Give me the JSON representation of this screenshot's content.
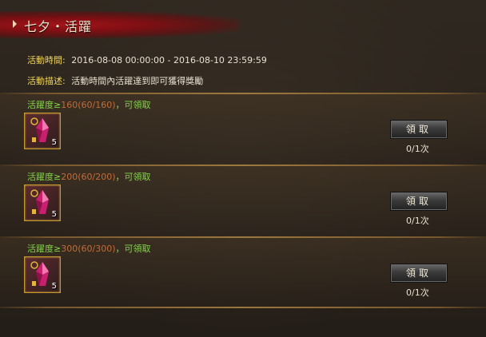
{
  "title": "七夕・活躍",
  "info": {
    "time_label": "活動時間:",
    "time_value": "2016-08-08 00:00:00  -  2016-08-10 23:59:59",
    "desc_label": "活動描述:",
    "desc_value": "活動時間內活躍達到即可獲得獎勵"
  },
  "rewards": [
    {
      "req_prefix": "活躍度≥",
      "req_value": "160(60/160)",
      "req_suffix": "，可領取",
      "item_count": "5",
      "button_label": "領取",
      "times": "0/1次"
    },
    {
      "req_prefix": "活躍度≥",
      "req_value": "200(60/200)",
      "req_suffix": "，可領取",
      "item_count": "5",
      "button_label": "領取",
      "times": "0/1次"
    },
    {
      "req_prefix": "活躍度≥",
      "req_value": "300(60/300)",
      "req_suffix": "，可領取",
      "item_count": "5",
      "button_label": "領取",
      "times": "0/1次"
    }
  ],
  "colors": {
    "banner": "#a3141a",
    "requirement": "#83d24b",
    "requirement_value": "#c46b37",
    "label": "#f0d55a"
  }
}
